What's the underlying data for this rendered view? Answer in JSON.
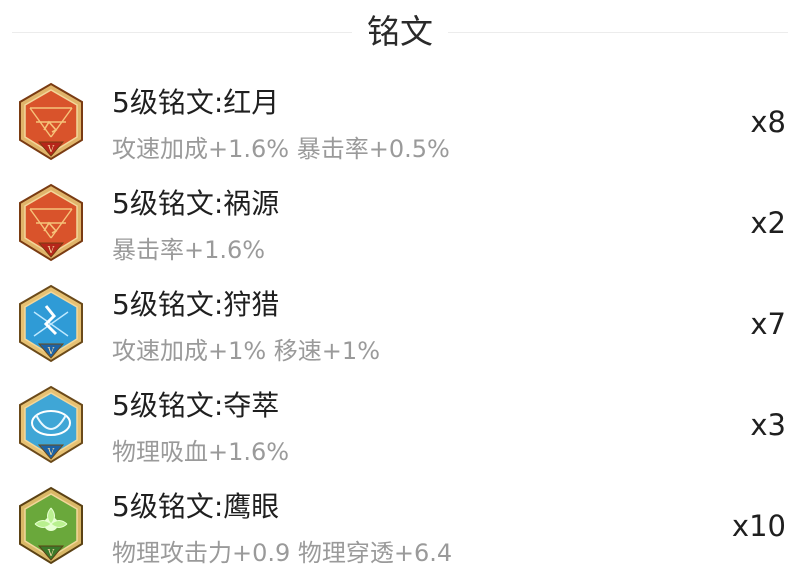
{
  "header": {
    "title": "铭文"
  },
  "inscriptions": [
    {
      "name": "5级铭文:红月",
      "effect": "攻速加成+1.6% 暴击率+0.5%",
      "count": "x8",
      "badge_color": "#d9532b",
      "badge_mark": "V",
      "icon": "red-inscription-icon"
    },
    {
      "name": "5级铭文:祸源",
      "effect": "暴击率+1.6%",
      "count": "x2",
      "badge_color": "#d9532b",
      "badge_mark": "V",
      "icon": "red-inscription-icon"
    },
    {
      "name": "5级铭文:狩猎",
      "effect": "攻速加成+1% 移速+1%",
      "count": "x7",
      "badge_color": "#2f9bd6",
      "badge_mark": "V",
      "icon": "blue-inscription-icon"
    },
    {
      "name": "5级铭文:夺萃",
      "effect": "物理吸血+1.6%",
      "count": "x3",
      "badge_color": "#3fa6d6",
      "badge_mark": "V",
      "icon": "blue-inscription-icon"
    },
    {
      "name": "5级铭文:鹰眼",
      "effect": "物理攻击力+0.9 物理穿透+6.4",
      "count": "x10",
      "badge_color": "#6aa83b",
      "badge_mark": "V",
      "icon": "green-inscription-icon"
    }
  ]
}
